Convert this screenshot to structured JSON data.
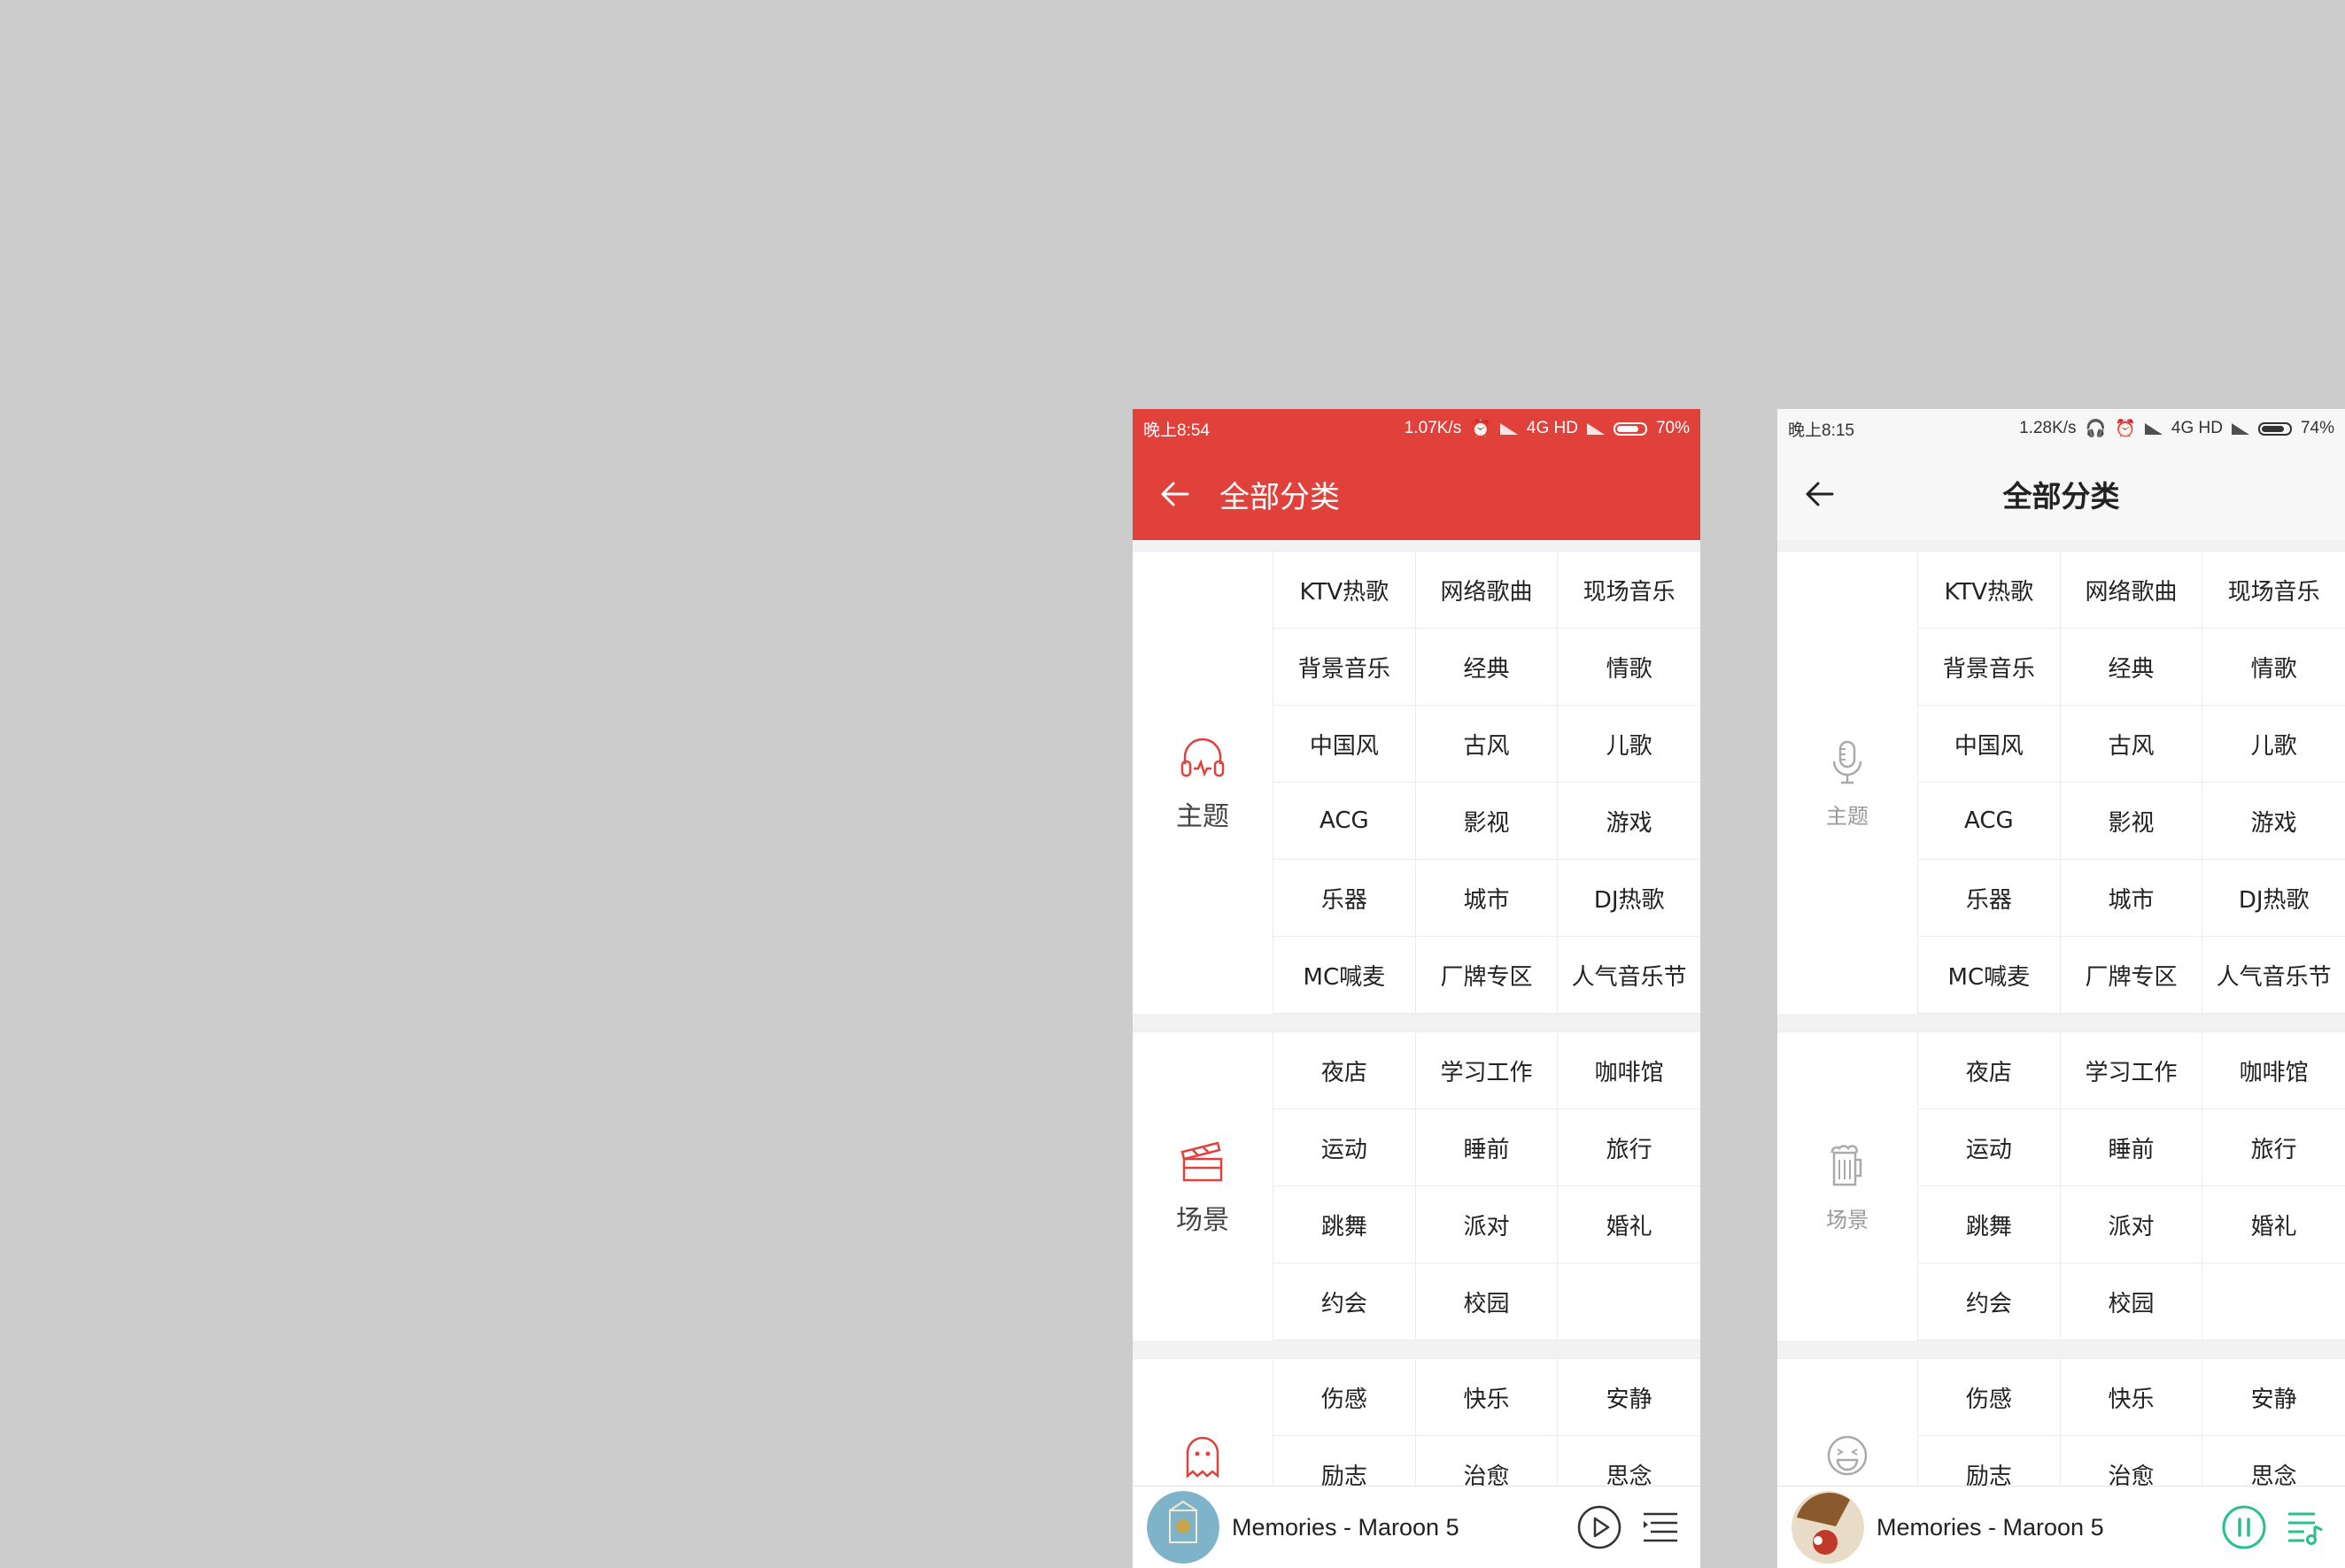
{
  "screens": [
    {
      "status": {
        "time": "晚上8:54",
        "speed": "1.07K/s",
        "network": "4G HD",
        "battery": "70%",
        "battery_level": 0.7
      },
      "title": "全部分类",
      "theme": {
        "bar": "#e0413a",
        "status_text": "#ffffff",
        "accent": "#e0413a"
      },
      "sections": [
        {
          "name": "主题",
          "icon": "headphones-icon",
          "items": [
            "KTV热歌",
            "网络歌曲",
            "现场音乐",
            "背景音乐",
            "经典",
            "情歌",
            "中国风",
            "古风",
            "儿歌",
            "ACG",
            "影视",
            "游戏",
            "乐器",
            "城市",
            "DJ热歌",
            "MC喊麦",
            "厂牌专区",
            "人气音乐节"
          ]
        },
        {
          "name": "场景",
          "icon": "clapperboard-icon",
          "items": [
            "夜店",
            "学习工作",
            "咖啡馆",
            "运动",
            "睡前",
            "旅行",
            "跳舞",
            "派对",
            "婚礼",
            "约会",
            "校园",
            ""
          ]
        },
        {
          "name": "",
          "icon": "ghost-icon",
          "items": [
            "伤感",
            "快乐",
            "安静",
            "励志",
            "治愈",
            "思念"
          ]
        }
      ],
      "player": {
        "song": "Memories - Maroon 5",
        "state": "paused",
        "cover": "album-cover"
      }
    },
    {
      "status": {
        "time": "晚上8:15",
        "speed": "1.28K/s",
        "network": "4G HD",
        "battery": "74%",
        "battery_level": 0.74
      },
      "title": "全部分类",
      "theme": {
        "bar": "#f7f7f7",
        "status_text": "#333333",
        "accent": "#2bbf8a"
      },
      "sections": [
        {
          "name": "主题",
          "icon": "microphone-icon",
          "items": [
            "KTV热歌",
            "网络歌曲",
            "现场音乐",
            "背景音乐",
            "经典",
            "情歌",
            "中国风",
            "古风",
            "儿歌",
            "ACG",
            "影视",
            "游戏",
            "乐器",
            "城市",
            "DJ热歌",
            "MC喊麦",
            "厂牌专区",
            "人气音乐节"
          ]
        },
        {
          "name": "场景",
          "icon": "beer-mug-icon",
          "items": [
            "夜店",
            "学习工作",
            "咖啡馆",
            "运动",
            "睡前",
            "旅行",
            "跳舞",
            "派对",
            "婚礼",
            "约会",
            "校园",
            ""
          ]
        },
        {
          "name": "",
          "icon": "laughing-face-icon",
          "items": [
            "伤感",
            "快乐",
            "安静",
            "励志",
            "治愈",
            "思念"
          ]
        }
      ],
      "player": {
        "song": "Memories - Maroon 5",
        "state": "playing",
        "cover": "album-cover"
      }
    }
  ]
}
